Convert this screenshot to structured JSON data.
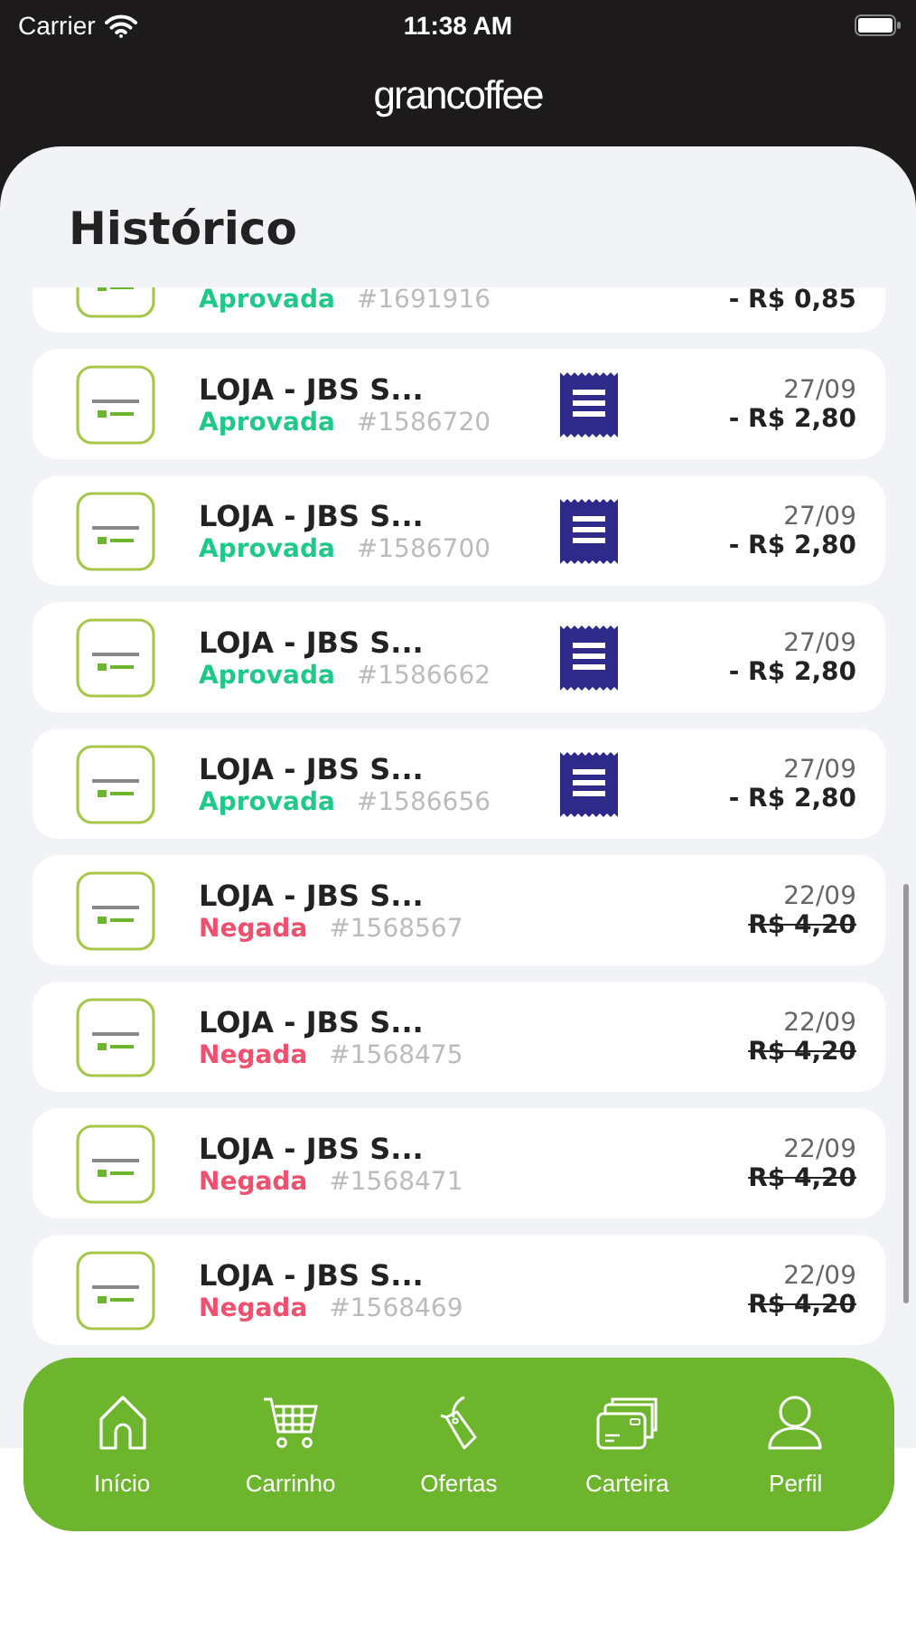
{
  "status_bar": {
    "carrier": "Carrier",
    "time": "11:38 AM"
  },
  "header": {
    "logo": "grancoffee"
  },
  "page_title": "Histórico",
  "transactions": [
    {
      "kind": "approved",
      "status_label": "Aprovada",
      "id": "#1691916",
      "amount": "- R$ 0,85",
      "has_receipt": false
    },
    {
      "name": "LOJA - JBS S...",
      "kind": "approved",
      "status_label": "Aprovada",
      "id": "#1586720",
      "date": "27/09",
      "amount": "- R$ 2,80",
      "has_receipt": true
    },
    {
      "name": "LOJA - JBS S...",
      "kind": "approved",
      "status_label": "Aprovada",
      "id": "#1586700",
      "date": "27/09",
      "amount": "- R$ 2,80",
      "has_receipt": true
    },
    {
      "name": "LOJA - JBS S...",
      "kind": "approved",
      "status_label": "Aprovada",
      "id": "#1586662",
      "date": "27/09",
      "amount": "- R$ 2,80",
      "has_receipt": true
    },
    {
      "name": "LOJA - JBS S...",
      "kind": "approved",
      "status_label": "Aprovada",
      "id": "#1586656",
      "date": "27/09",
      "amount": "- R$ 2,80",
      "has_receipt": true
    },
    {
      "name": "LOJA - JBS S...",
      "kind": "denied",
      "status_label": "Negada",
      "id": "#1568567",
      "date": "22/09",
      "amount": "R$ 4,20",
      "has_receipt": false
    },
    {
      "name": "LOJA - JBS S...",
      "kind": "denied",
      "status_label": "Negada",
      "id": "#1568475",
      "date": "22/09",
      "amount": "R$ 4,20",
      "has_receipt": false
    },
    {
      "name": "LOJA - JBS S...",
      "kind": "denied",
      "status_label": "Negada",
      "id": "#1568471",
      "date": "22/09",
      "amount": "R$ 4,20",
      "has_receipt": false
    },
    {
      "name": "LOJA - JBS S...",
      "kind": "denied",
      "status_label": "Negada",
      "id": "#1568469",
      "date": "22/09",
      "amount": "R$ 4,20",
      "has_receipt": false
    }
  ],
  "tab_bar": [
    {
      "kind": "home",
      "label": "Início"
    },
    {
      "kind": "cart",
      "label": "Carrinho"
    },
    {
      "kind": "offers",
      "label": "Ofertas"
    },
    {
      "kind": "wallet",
      "label": "Carteira"
    },
    {
      "kind": "profile",
      "label": "Perfil"
    }
  ]
}
